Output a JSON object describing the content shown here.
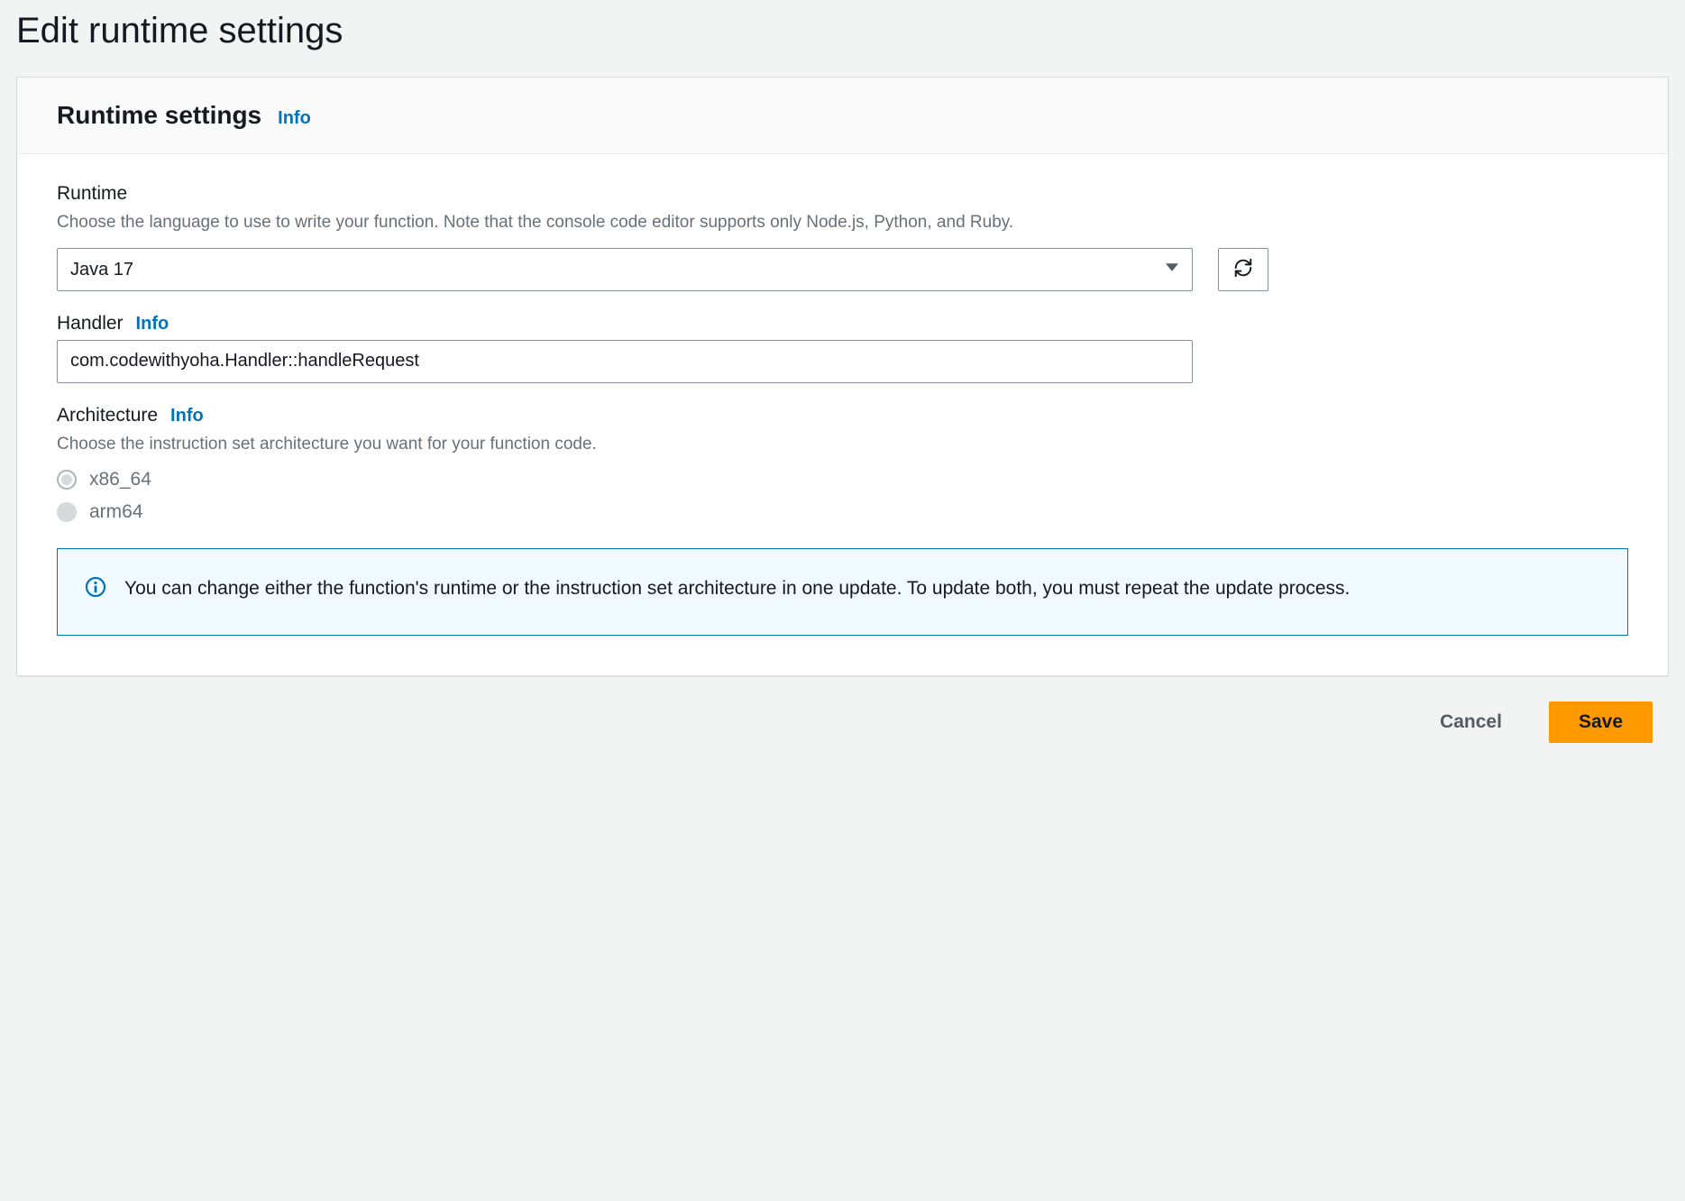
{
  "page": {
    "title": "Edit runtime settings"
  },
  "panel": {
    "title": "Runtime settings",
    "info_label": "Info"
  },
  "runtime": {
    "label": "Runtime",
    "hint": "Choose the language to use to write your function. Note that the console code editor supports only Node.js, Python, and Ruby.",
    "selected": "Java 17"
  },
  "handler": {
    "label": "Handler",
    "info_label": "Info",
    "value": "com.codewithyoha.Handler::handleRequest"
  },
  "architecture": {
    "label": "Architecture",
    "info_label": "Info",
    "hint": "Choose the instruction set architecture you want for your function code.",
    "options": {
      "x86_64": "x86_64",
      "arm64": "arm64"
    },
    "selected": "x86_64"
  },
  "alert": {
    "text": "You can change either the function's runtime or the instruction set architecture in one update. To update both, you must repeat the update process."
  },
  "footer": {
    "cancel": "Cancel",
    "save": "Save"
  }
}
